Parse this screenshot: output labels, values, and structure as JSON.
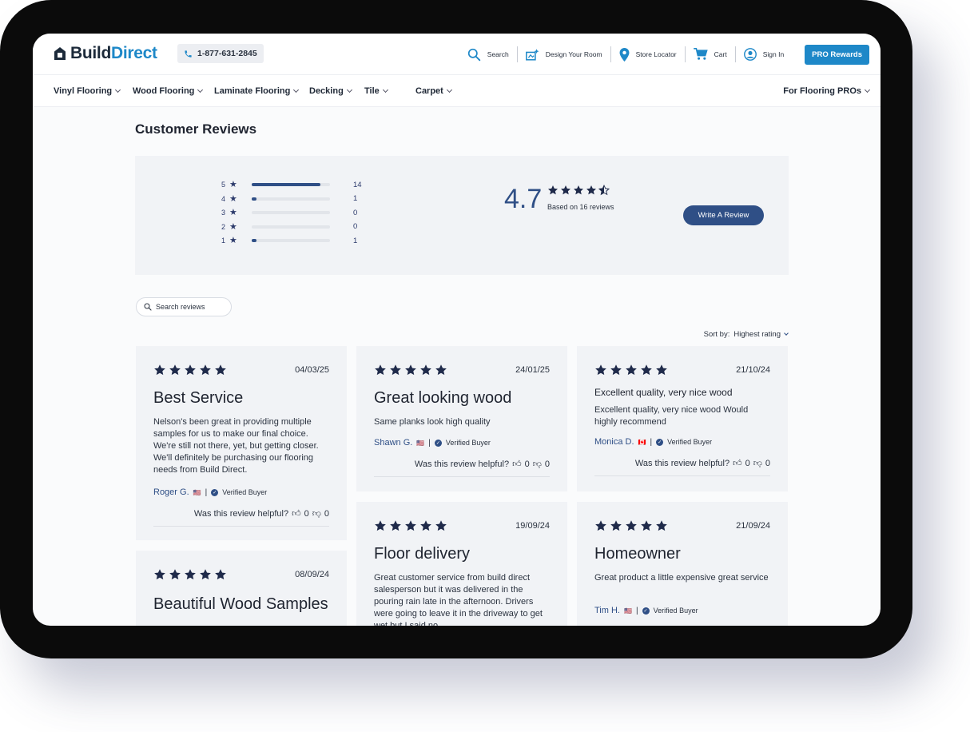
{
  "header": {
    "logo_build": "Build",
    "logo_direct": "Direct",
    "phone": "1-877-631-2845",
    "search": "Search",
    "design": "Design Your Room",
    "store": "Store Locator",
    "cart": "Cart",
    "signin": "Sign In",
    "pro": "PRO Rewards"
  },
  "nav": {
    "vinyl": "Vinyl Flooring",
    "wood": "Wood Flooring",
    "laminate": "Laminate Flooring",
    "decking": "Decking",
    "tile": "Tile",
    "carpet": "Carpet",
    "pros": "For Flooring PROs"
  },
  "page": {
    "title": "Customer Reviews"
  },
  "summary": {
    "rating": "4.7",
    "based_on": "Based on 16 reviews",
    "write_review": "Write A Review",
    "histogram": [
      {
        "stars": "5",
        "count": "14",
        "fraction": 0.875
      },
      {
        "stars": "4",
        "count": "1",
        "fraction": 0.0625
      },
      {
        "stars": "3",
        "count": "0",
        "fraction": 0
      },
      {
        "stars": "2",
        "count": "0",
        "fraction": 0
      },
      {
        "stars": "1",
        "count": "1",
        "fraction": 0.0625
      }
    ]
  },
  "controls": {
    "search_placeholder": "Search reviews",
    "sort_label": "Sort by:",
    "sort_value": "Highest rating"
  },
  "reviews": [
    {
      "date": "04/03/25",
      "title": "Best Service",
      "body": "Nelson's been great in providing multiple samples for us to make our final choice. We're still not there, yet, but getting closer. We'll definitely be purchasing our flooring needs from Build Direct.",
      "reviewer": "Roger G.",
      "verified": "Verified Buyer",
      "helpful": "Was this review helpful?",
      "up": "0",
      "down": "0"
    },
    {
      "date": "24/01/25",
      "title": "Great looking wood",
      "body": "Same planks look high quality",
      "reviewer": "Shawn G.",
      "verified": "Verified Buyer",
      "helpful": "Was this review helpful?",
      "up": "0",
      "down": "0"
    },
    {
      "date": "21/10/24",
      "title": "Excellent quality, very nice wood",
      "body": "Excellent quality, very nice wood Would highly recommend",
      "reviewer": "Monica D.",
      "verified": "Verified Buyer",
      "helpful": "Was this review helpful?",
      "up": "0",
      "down": "0"
    },
    {
      "date": "08/09/24",
      "title": "Beautiful Wood Samples"
    },
    {
      "date": "19/09/24",
      "title": "Floor delivery",
      "body": "Great customer service from build direct salesperson but it was delivered in the pouring rain late in the afternoon. Drivers were going to leave it in the driveway to get wet but I said no."
    },
    {
      "date": "21/09/24",
      "title": "Homeowner",
      "body": "Great product a little expensive great service",
      "reviewer": "Tim H.",
      "verified": "Verified Buyer"
    }
  ],
  "colors": {
    "accent": "#1e88c8",
    "navy": "#2f4f86",
    "star": "#1f2a4a"
  }
}
